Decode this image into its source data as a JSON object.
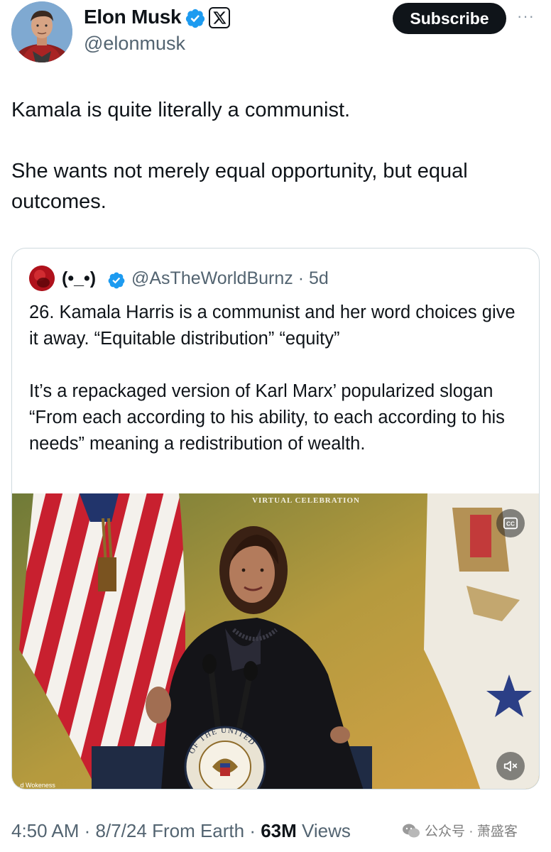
{
  "author": {
    "name": "Elon Musk",
    "handle": "@elonmusk",
    "verified_color": "#1d9bf0"
  },
  "header": {
    "subscribe_label": "Subscribe",
    "more_label": "···"
  },
  "tweet": {
    "paragraphs": [
      "Kamala is quite literally a communist.",
      "She wants not merely equal opportunity, but equal outcomes."
    ]
  },
  "quote": {
    "name": "(•_•)",
    "handle": "@AsTheWorldBurnz",
    "age": "· 5d",
    "paragraphs": [
      "26. Kamala Harris is a communist and her word choices give it away. “Equitable distribution” “equity”",
      "It’s a repackaged version of Karl Marx’ popularized slogan “From each according to his ability, to each according to his needs” meaning a redistribution of wealth."
    ],
    "video": {
      "overlay_title": "VIRTUAL CELEBRATION",
      "cc_label": "CC",
      "seal_text": "OF THE UNITED",
      "caption": "...d Wokeness"
    }
  },
  "meta": {
    "time": "4:50 AM",
    "date": "8/7/24",
    "source": "From Earth",
    "views_count": "63M",
    "views_label": "Views"
  },
  "watermark": {
    "text": "公众号 · 萧盛客"
  },
  "colors": {
    "text": "#0f1419",
    "secondary": "#536471",
    "border": "#cfd9de"
  }
}
